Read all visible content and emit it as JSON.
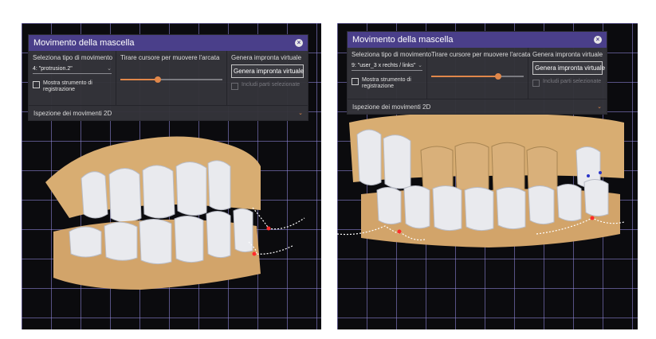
{
  "panels": [
    {
      "dialog": {
        "title": "Movimento della mascella",
        "col1_label": "Seleziona tipo di movimento",
        "movement_value": "4: \"protrusion.2\"",
        "checkbox_label": "Mostra strumento di registrazione",
        "col2_label": "Tirare cursore per muovere l'arcata",
        "slider_value": 0.37,
        "col3_label": "Genera impronta virtuale",
        "button_label": "Genera impronta virtuale",
        "include_label": "Includi parti selezionate",
        "footer_label": "Ispezione dei movimenti 2D"
      }
    },
    {
      "dialog": {
        "title": "Movimento della mascella",
        "col1_label": "Seleziona tipo di movimento",
        "movement_value": "9: \"user_3 x rechts / links\"",
        "checkbox_label": "Mostra strumento di registrazione",
        "col2_label": "Tirare cursore per muovere l'arcata",
        "slider_value": 0.72,
        "col3_label": "Genera impronta virtuale",
        "button_label": "Genera impronta virtuale",
        "include_label": "Includi parti selezionate",
        "footer_label": "Ispezione dei movimenti 2D"
      }
    }
  ],
  "colors": {
    "titlebar": "#4a3f8a",
    "slider_accent": "#e0874a",
    "gingiva": "#d8ad72",
    "tooth": "#e9eaee",
    "grid": "#968ce6"
  }
}
